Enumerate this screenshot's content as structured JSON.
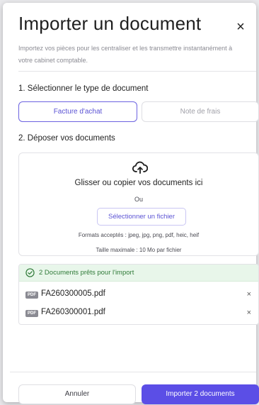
{
  "modal": {
    "title": "Importer un document",
    "close_icon": "×",
    "subtitle": "Importez vos pièces pour les centraliser et les transmettre instantanément à votre cabinet comptable."
  },
  "step1": {
    "label": "1. Sélectionner le type de document",
    "options": [
      {
        "label": "Facture d'achat",
        "selected": true
      },
      {
        "label": "Note de frais",
        "selected": false
      }
    ]
  },
  "step2": {
    "label": "2. Déposer vos documents",
    "dropzone": {
      "icon": "cloud-upload-icon",
      "title": "Glisser ou copier vos documents ici",
      "or": "Ou",
      "select_button": "Sélectionner un fichier",
      "formats": "Formats acceptés : jpeg, jpg, png, pdf, heic, heif",
      "max_size": "Taille maximale : 10 Mo par fichier"
    }
  },
  "ready": {
    "icon": "check-circle-icon",
    "text": "2 Documents prêts pour l'import",
    "files": [
      {
        "badge": "PDF",
        "name": "FA260300005.pdf",
        "remove_icon": "×"
      },
      {
        "badge": "PDF",
        "name": "FA260300001.pdf",
        "remove_icon": "×"
      }
    ]
  },
  "footer": {
    "cancel": "Annuler",
    "import": "Importer 2 documents"
  },
  "colors": {
    "accent": "#5b4ee6",
    "success": "#2f7a38",
    "success_bg": "#e8f6ea"
  }
}
